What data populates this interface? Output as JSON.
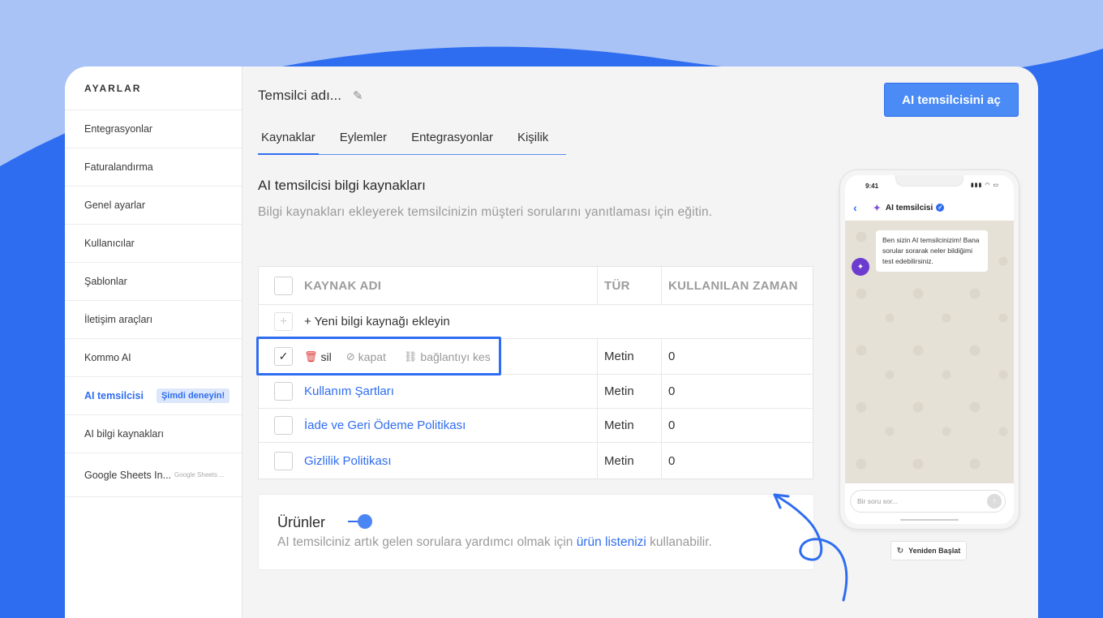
{
  "colors": {
    "accent": "#2f6df0",
    "background_top": "#a9c3f7",
    "background_bottom": "#2f6df0",
    "delete": "#dd3333",
    "bot_avatar": "#6c3bd0"
  },
  "sidebar": {
    "title": "AYARLAR",
    "items": [
      {
        "label": "Entegrasyonlar"
      },
      {
        "label": "Faturalandırma"
      },
      {
        "label": "Genel ayarlar"
      },
      {
        "label": "Kullanıcılar"
      },
      {
        "label": "Şablonlar"
      },
      {
        "label": "İletişim araçları"
      },
      {
        "label": "Kommo AI"
      },
      {
        "label": "AI temsilcisi",
        "badge": "Şimdi deneyin!",
        "active": true
      },
      {
        "label": "AI bilgi kaynakları"
      },
      {
        "label": "Google Sheets In...",
        "sub": "Google Sheets ..."
      }
    ]
  },
  "header": {
    "agent_name": "Temsilci adı...",
    "edit_icon": "pencil-icon",
    "open_button": "AI temsilcisini aç"
  },
  "tabs": [
    {
      "label": "Kaynaklar",
      "active": true
    },
    {
      "label": "Eylemler"
    },
    {
      "label": "Entegrasyonlar"
    },
    {
      "label": "Kişilik"
    }
  ],
  "section": {
    "title": "AI temsilcisi bilgi kaynakları",
    "description": "Bilgi kaynakları ekleyerek temsilcinizin müşteri sorularını yanıtlaması için eğitin."
  },
  "table": {
    "headers": {
      "name": "KAYNAK ADI",
      "type": "TÜR",
      "used": "KULLANILAN ZAMAN"
    },
    "add_label": "+ Yeni bilgi kaynağı ekleyin",
    "actions": {
      "delete": "sil",
      "hide": "kapat",
      "unlink": "bağlantıyı kes"
    },
    "selected_row": {
      "type": "Metin",
      "used": "0"
    },
    "rows": [
      {
        "name": "Kullanım Şartları",
        "type": "Metin",
        "used": "0"
      },
      {
        "name": "İade ve Geri Ödeme Politikası",
        "type": "Metin",
        "used": "0"
      },
      {
        "name": "Gizlilik Politikası",
        "type": "Metin",
        "used": "0"
      }
    ]
  },
  "products": {
    "title": "Ürünler",
    "toggle_on": true,
    "desc_before": "AI temsilciniz artık gelen sorulara yardımcı olmak için ",
    "desc_link": "ürün listenizi",
    "desc_after": " kullanabilir."
  },
  "phone": {
    "time": "9:41",
    "chat_title": "AI temsilcisi",
    "message": "Ben sizin AI temsilcinizim! Bana sorular sorarak neler bildiğimi test edebilirsiniz.",
    "input_placeholder": "Bir soru sor...",
    "restart_label": "Yeniden Başlat"
  }
}
